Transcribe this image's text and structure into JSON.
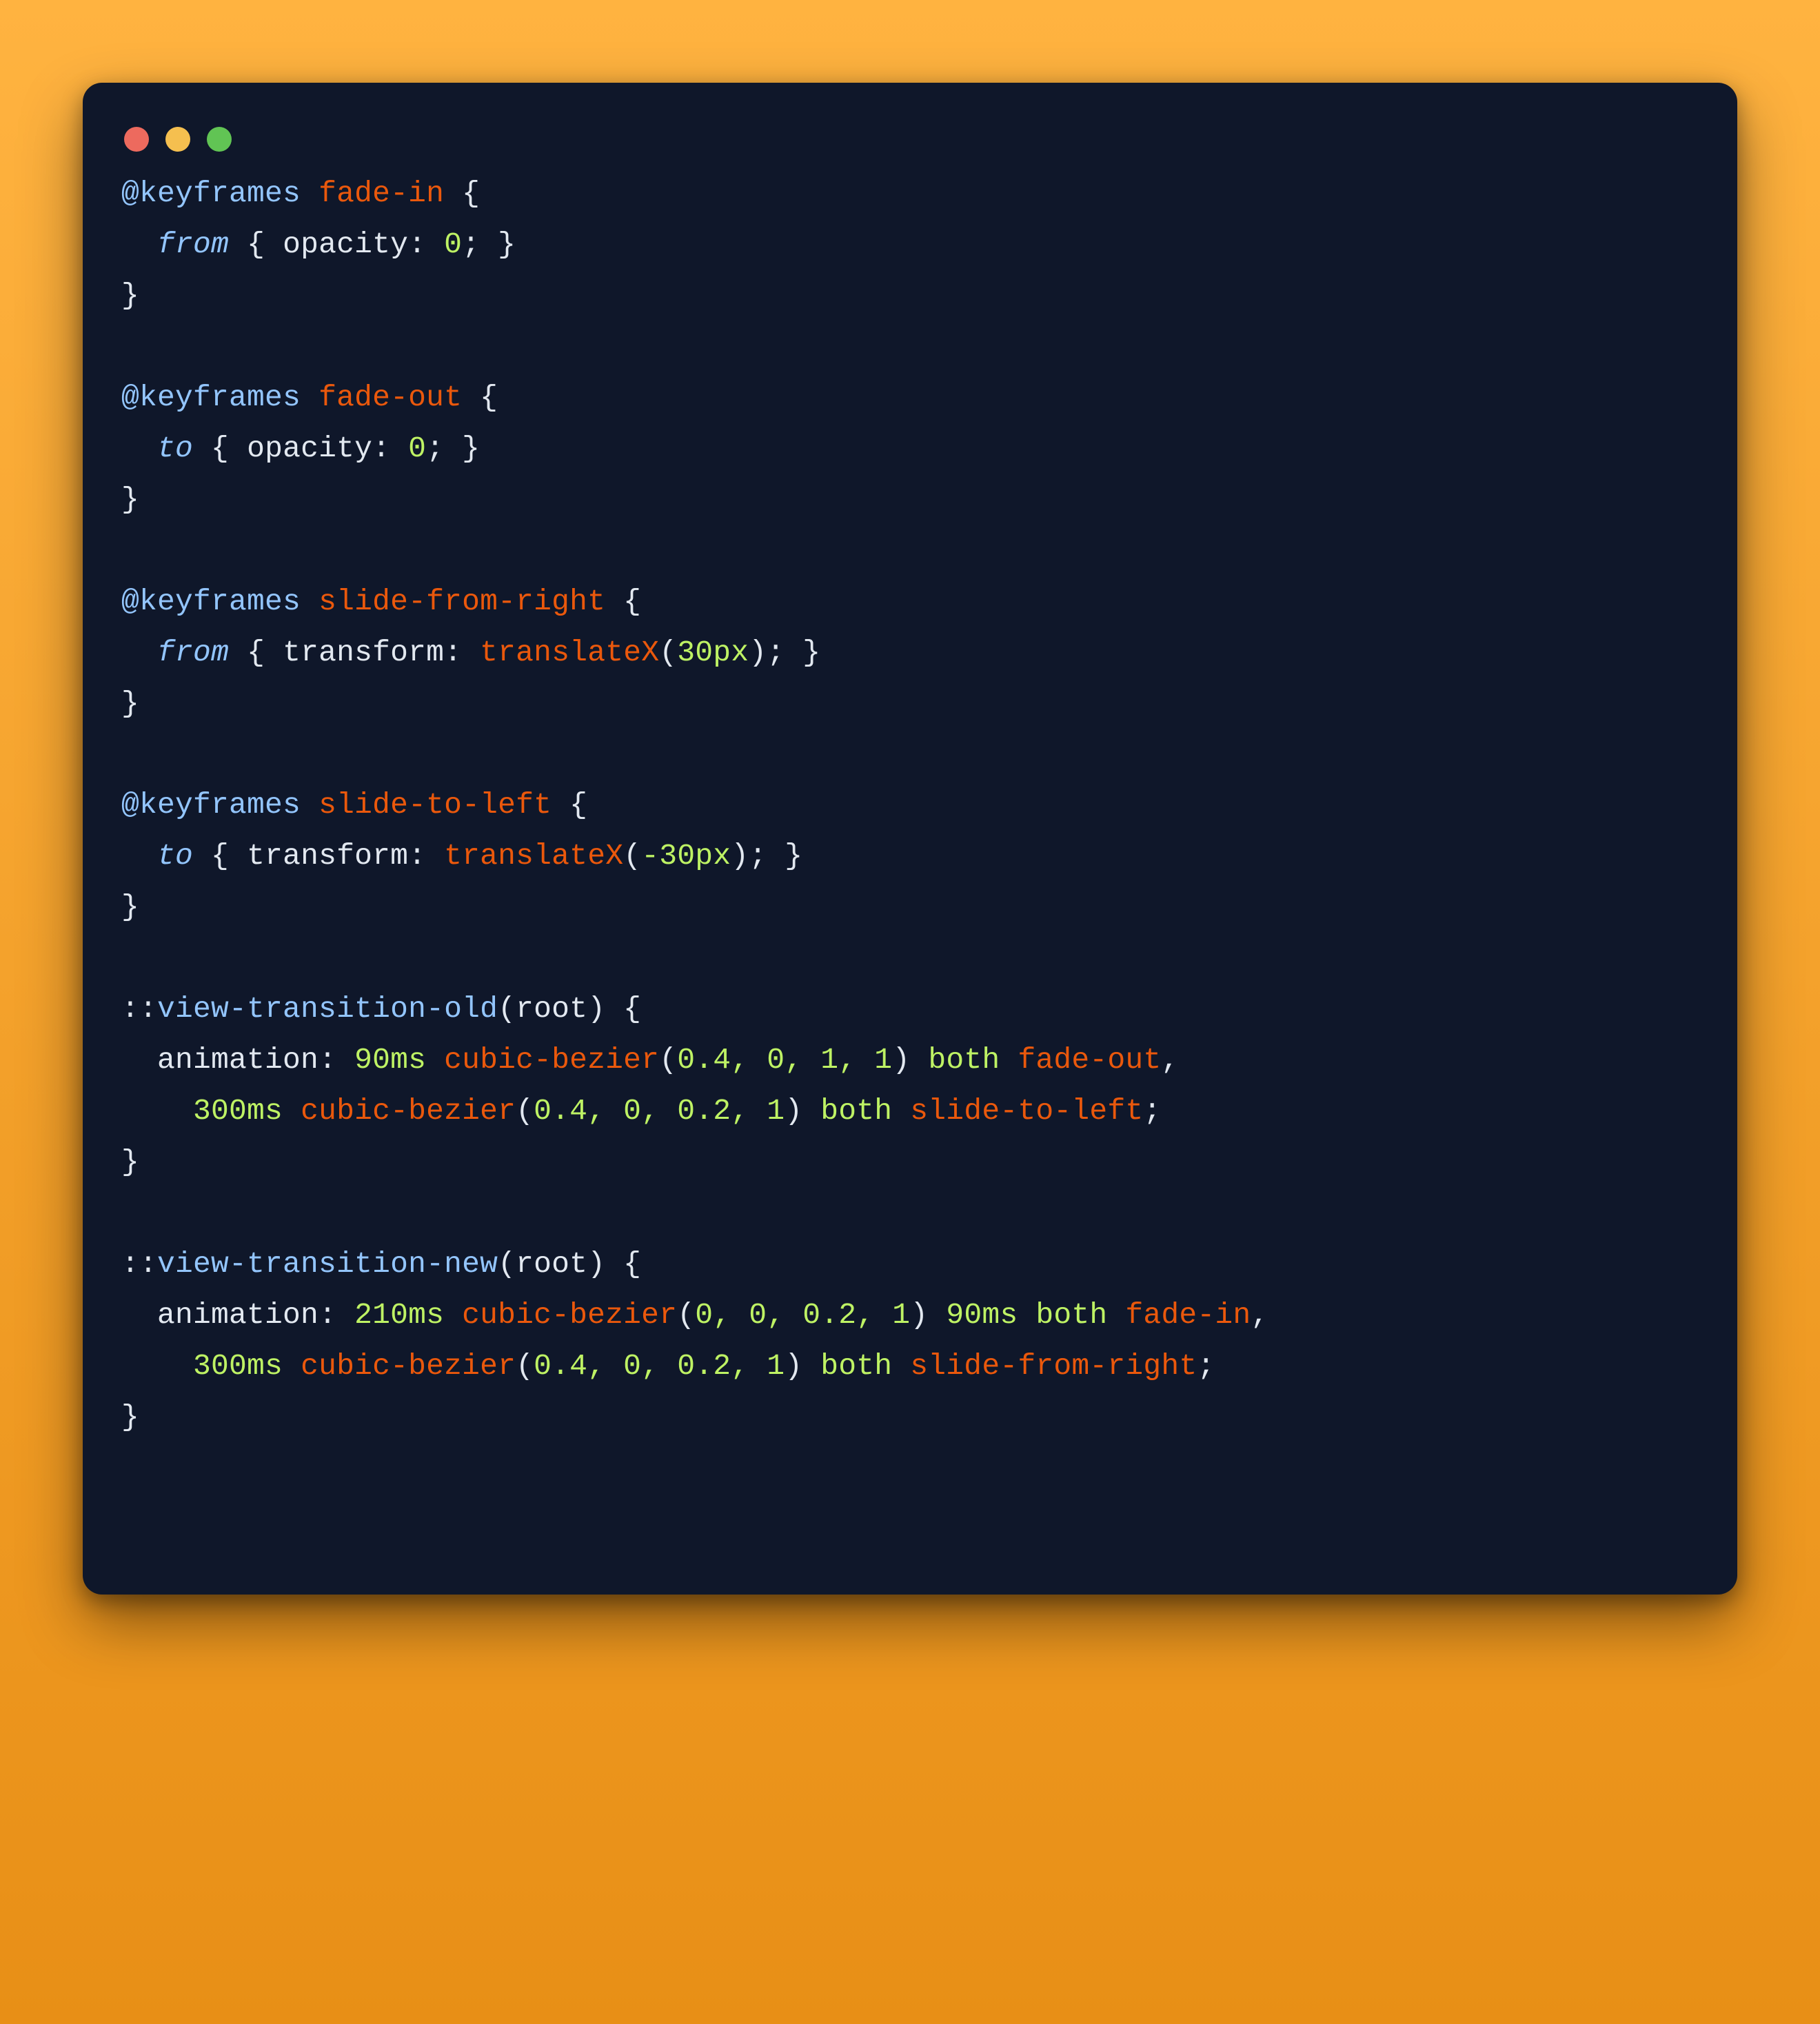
{
  "window": {
    "controls": [
      "close",
      "minimize",
      "zoom"
    ]
  },
  "code": {
    "keyframes": [
      {
        "name": "fade-in",
        "rules": [
          {
            "selector": "from",
            "property": "opacity",
            "value": "0"
          }
        ]
      },
      {
        "name": "fade-out",
        "rules": [
          {
            "selector": "to",
            "property": "opacity",
            "value": "0"
          }
        ]
      },
      {
        "name": "slide-from-right",
        "rules": [
          {
            "selector": "from",
            "property": "transform",
            "func": "translateX",
            "arg": "30px"
          }
        ]
      },
      {
        "name": "slide-to-left",
        "rules": [
          {
            "selector": "to",
            "property": "transform",
            "func": "translateX",
            "arg": "-30px"
          }
        ]
      }
    ],
    "transitions": [
      {
        "pseudo": "view-transition-old",
        "target": "root",
        "animations": [
          {
            "duration": "90ms",
            "easing": "cubic-bezier",
            "easing_args": "0.4, 0, 1, 1",
            "fill": "both",
            "name": "fade-out"
          },
          {
            "duration": "300ms",
            "easing": "cubic-bezier",
            "easing_args": "0.4, 0, 0.2, 1",
            "fill": "both",
            "name": "slide-to-left"
          }
        ]
      },
      {
        "pseudo": "view-transition-new",
        "target": "root",
        "animations": [
          {
            "duration": "210ms",
            "easing": "cubic-bezier",
            "easing_args": "0, 0, 0.2, 1",
            "delay": "90ms",
            "fill": "both",
            "name": "fade-in"
          },
          {
            "duration": "300ms",
            "easing": "cubic-bezier",
            "easing_args": "0.4, 0, 0.2, 1",
            "fill": "both",
            "name": "slide-from-right"
          }
        ]
      }
    ]
  }
}
